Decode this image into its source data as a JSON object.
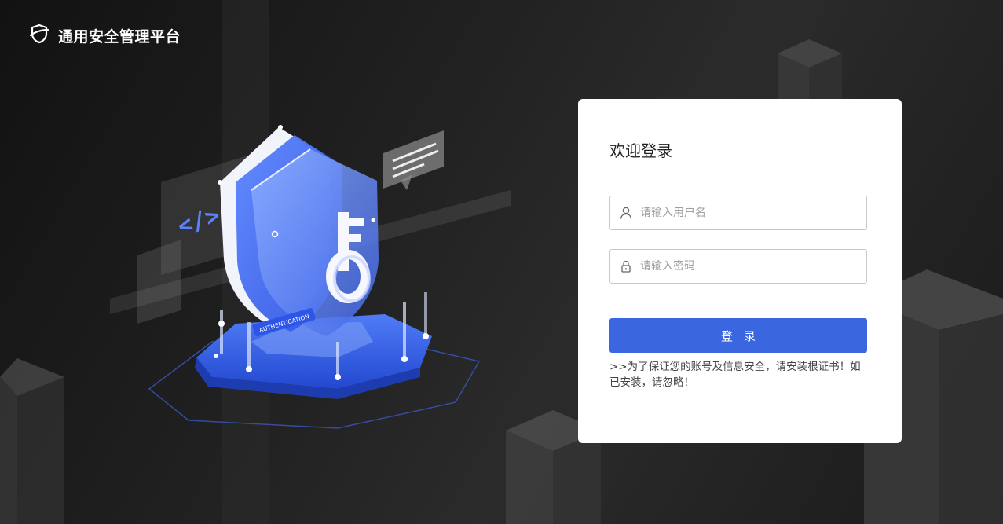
{
  "brand": {
    "title": "通用安全管理平台",
    "icon": "shield-icon"
  },
  "illustration": {
    "badge_text": "AUTHENTICATION",
    "code_glyph": "</>"
  },
  "login": {
    "title": "欢迎登录",
    "username": {
      "placeholder": "请输入用户名",
      "value": "",
      "icon": "user-icon"
    },
    "password": {
      "placeholder": "请输入密码",
      "value": "",
      "icon": "lock-icon"
    },
    "submit_label": "登录",
    "cert_notice": ">>为了保证您的账号及信息安全，请安装根证书！如已安装，请忽略！"
  },
  "colors": {
    "accent": "#3a67e0",
    "background": "#222222",
    "card": "#ffffff"
  }
}
